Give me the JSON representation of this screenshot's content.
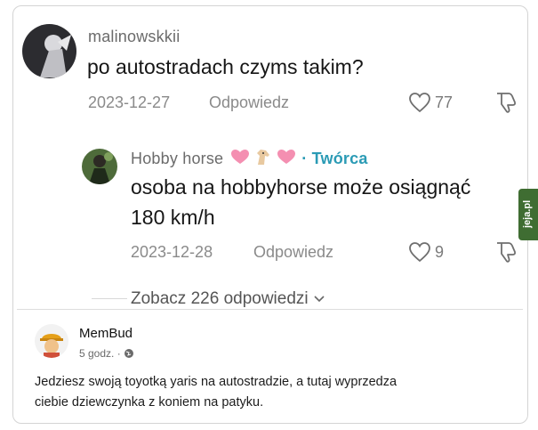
{
  "comments": [
    {
      "username": "malinowskkii",
      "text": "po autostradach czyms takim?",
      "date": "2023-12-27",
      "reply_label": "Odpowiedz",
      "likes": "77"
    },
    {
      "username": "Hobby horse",
      "creator_label": "· Twórca",
      "text_line1": "osoba na hobbyhorse może osiągnąć",
      "text_line2": "180 km/h",
      "date": "2023-12-28",
      "reply_label": "Odpowiedz",
      "likes": "9"
    }
  ],
  "view_replies": "Zobacz 226 odpowiedzi",
  "facebook_post": {
    "author": "MemBud",
    "time": "5 godz. ·",
    "text_line1": "Jedziesz swoją toyotką yaris na autostradzie, a tutaj wyprzedza",
    "text_line2": "ciebie dziewczynka z koniem na patyku."
  },
  "watermark": "jeja.pl",
  "colors": {
    "creator": "#2b9bb5",
    "watermark_bg": "#3f6d32"
  }
}
